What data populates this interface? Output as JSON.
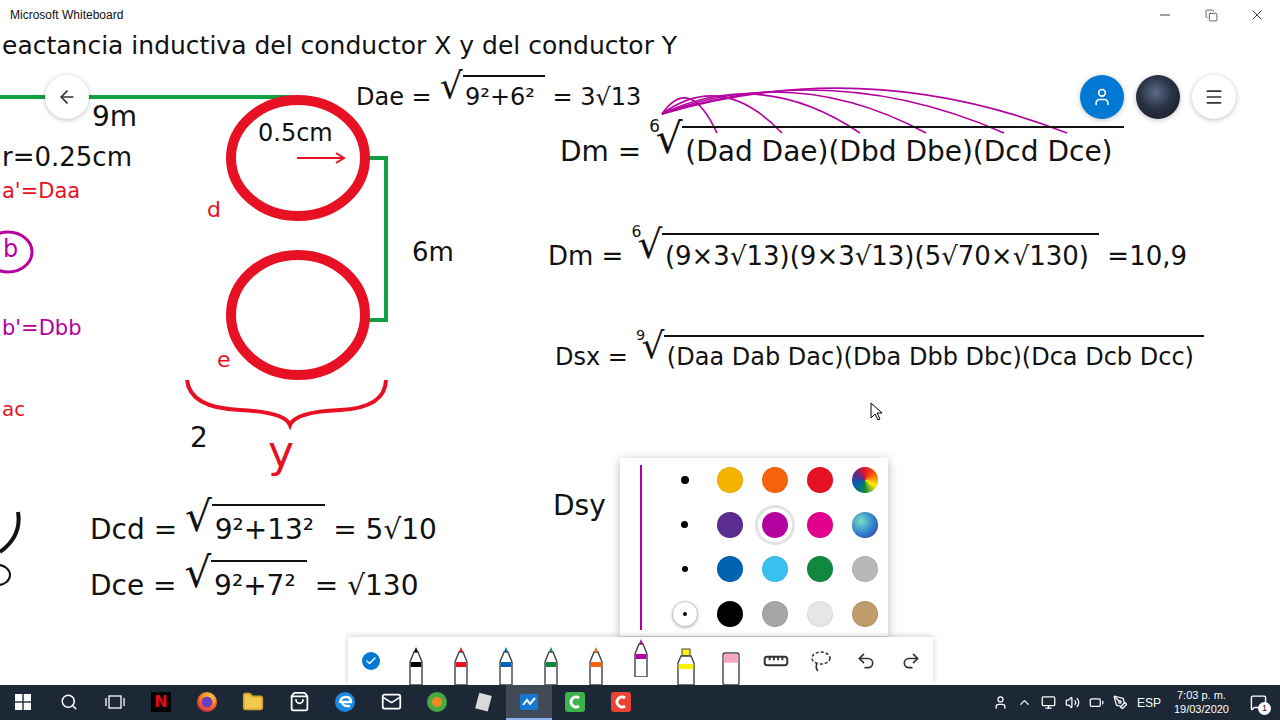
{
  "window": {
    "title": "Microsoft Whiteboard"
  },
  "canvas": {
    "heading": "eactancia inductiva del conductor X y del conductor Y",
    "labels": [
      {
        "text": "9m",
        "color": "#111111"
      },
      {
        "text": "r=0.25cm",
        "color": "#111111"
      },
      {
        "text": "a'=Daa",
        "color": "#e81123"
      },
      {
        "text": "b",
        "color": "#b4009e"
      },
      {
        "text": "b'=Dbb",
        "color": "#b4009e"
      },
      {
        "text": "ac",
        "color": "#e81123"
      },
      {
        "text": "0.5cm",
        "color": "#111111"
      },
      {
        "text": "d",
        "color": "#e81123"
      },
      {
        "text": "e",
        "color": "#e81123"
      },
      {
        "text": "6m",
        "color": "#111111"
      },
      {
        "text": "2",
        "color": "#111111"
      },
      {
        "text": "y",
        "color": "#e81123"
      }
    ],
    "formulas": [
      {
        "pieces": [
          {
            "kind": "text",
            "text": "Dae ="
          },
          {
            "kind": "root",
            "sign": "√",
            "text": "9²+6²"
          },
          {
            "kind": "text",
            "text": "= 3√13"
          }
        ]
      },
      {
        "pieces": [
          {
            "kind": "text",
            "text": "Dm ="
          },
          {
            "kind": "root",
            "sign": "√",
            "index": "6",
            "text": "(Dad Dae)(Dbd Dbe)(Dcd Dce)"
          }
        ]
      },
      {
        "pieces": [
          {
            "kind": "text",
            "text": "Dm ="
          },
          {
            "kind": "root",
            "sign": "√",
            "index": "6",
            "text": "(9×3√13)(9×3√13)(5√70×√130)"
          },
          {
            "kind": "text",
            "text": "=10,9"
          }
        ]
      },
      {
        "pieces": [
          {
            "kind": "text",
            "text": "Dsx ="
          },
          {
            "kind": "root",
            "sign": "√",
            "index": "9",
            "text": "(Daa Dab Dac)(Dba Dbb Dbc)(Dca Dcb Dcc)"
          }
        ]
      },
      {
        "pieces": [
          {
            "kind": "text",
            "text": "Dsy"
          }
        ]
      },
      {
        "pieces": [
          {
            "kind": "text",
            "text": "Dcd ="
          },
          {
            "kind": "root",
            "sign": "√",
            "text": "9²+13²"
          },
          {
            "kind": "text",
            "text": "= 5√10"
          }
        ]
      },
      {
        "pieces": [
          {
            "kind": "text",
            "text": "Dce ="
          },
          {
            "kind": "root",
            "sign": "√",
            "text": "9²+7²"
          },
          {
            "kind": "text",
            "text": "= √130"
          }
        ]
      }
    ]
  },
  "palette": {
    "thickness": [
      {
        "selected": false
      },
      {
        "selected": false
      },
      {
        "selected": false
      },
      {
        "selected": true
      }
    ],
    "swatches": [
      {
        "color": "#f5b400",
        "kind": "solid",
        "selected": false
      },
      {
        "color": "#f7630c",
        "kind": "solid",
        "selected": false
      },
      {
        "color": "#e81123",
        "kind": "solid",
        "selected": false
      },
      {
        "color": "#e81123",
        "kind": "rainbow",
        "selected": false
      },
      {
        "color": "#5c2d91",
        "kind": "solid",
        "selected": false
      },
      {
        "color": "#b4009e",
        "kind": "solid",
        "selected": true
      },
      {
        "color": "#e3008c",
        "kind": "solid",
        "selected": false
      },
      {
        "color": "#2d7dd2",
        "kind": "galaxy",
        "selected": false
      },
      {
        "color": "#0063b1",
        "kind": "solid",
        "selected": false
      },
      {
        "color": "#38c1f0",
        "kind": "solid",
        "selected": false
      },
      {
        "color": "#10893e",
        "kind": "solid",
        "selected": false
      },
      {
        "color": "#b8b8b8",
        "kind": "solid",
        "selected": false
      },
      {
        "color": "#000000",
        "kind": "solid",
        "selected": false
      },
      {
        "color": "#a6a6a6",
        "kind": "solid",
        "selected": false
      },
      {
        "color": "#e6e6e6",
        "kind": "solid",
        "selected": false
      },
      {
        "color": "#c19c6b",
        "kind": "solid",
        "selected": false
      }
    ]
  },
  "toolbar": {
    "tools": [
      {
        "kind": "toggle",
        "selected": false
      },
      {
        "kind": "pen",
        "color": "#000000",
        "selected": false
      },
      {
        "kind": "pen",
        "color": "#e81123",
        "selected": false
      },
      {
        "kind": "pen",
        "color": "#0063b1",
        "selected": false
      },
      {
        "kind": "pen",
        "color": "#10893e",
        "selected": false
      },
      {
        "kind": "pen",
        "color": "#f7630c",
        "selected": false
      },
      {
        "kind": "pen",
        "color": "#b4009e",
        "selected": true
      },
      {
        "kind": "highlighter",
        "color": "#fff100",
        "selected": false
      },
      {
        "kind": "eraser",
        "selected": false
      },
      {
        "kind": "ruler",
        "selected": false
      },
      {
        "kind": "lasso",
        "selected": false
      },
      {
        "kind": "undo",
        "selected": false
      },
      {
        "kind": "redo",
        "selected": false
      }
    ]
  },
  "taskbar": {
    "apps": [
      {
        "kind": "netflix",
        "label": "N",
        "active": false
      },
      {
        "kind": "firefox",
        "active": false
      },
      {
        "kind": "files",
        "active": false
      },
      {
        "kind": "store",
        "active": false
      },
      {
        "kind": "edge",
        "active": false
      },
      {
        "kind": "mail",
        "active": false
      },
      {
        "kind": "game",
        "active": false
      },
      {
        "kind": "notes",
        "active": false
      },
      {
        "kind": "whiteboard",
        "active": true
      },
      {
        "kind": "camtasia",
        "active": false
      },
      {
        "kind": "recorder",
        "active": false
      }
    ],
    "language": "ESP",
    "time": "7:03 p. m.",
    "date": "19/03/2020",
    "notifications": "1"
  }
}
